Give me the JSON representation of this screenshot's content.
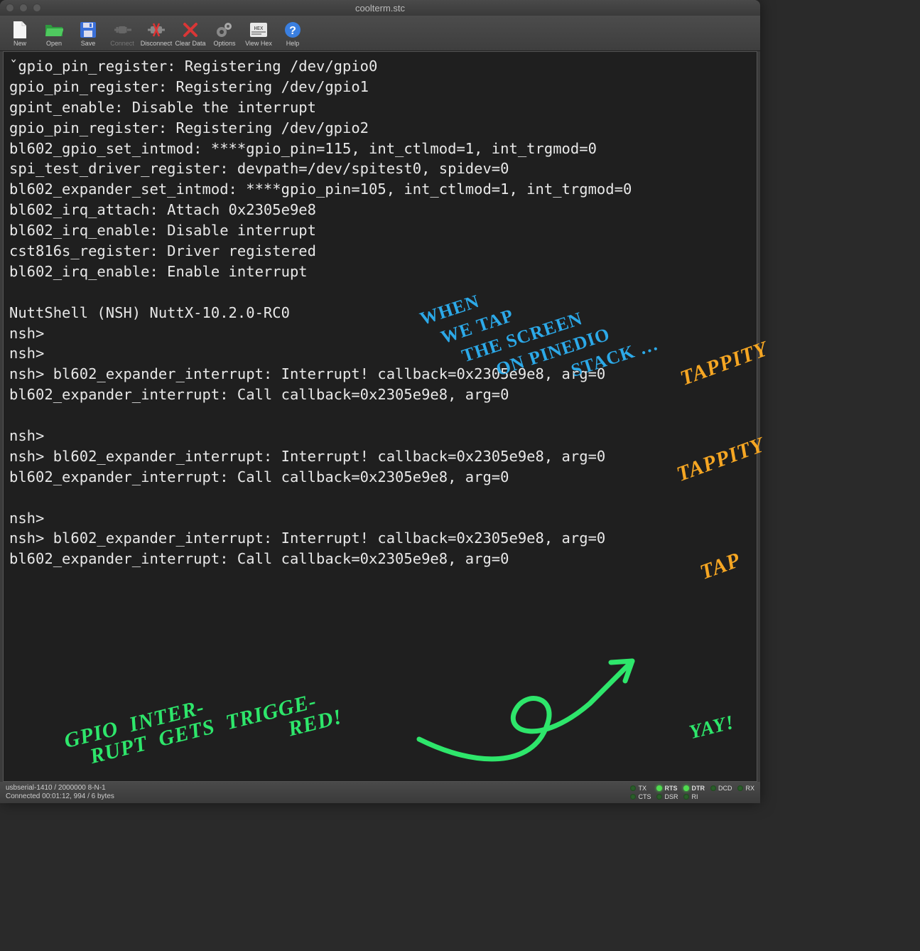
{
  "window": {
    "title": "coolterm.stc"
  },
  "toolbar": [
    {
      "id": "new",
      "label": "New",
      "disabled": false
    },
    {
      "id": "open",
      "label": "Open",
      "disabled": false
    },
    {
      "id": "save",
      "label": "Save",
      "disabled": false
    },
    {
      "id": "connect",
      "label": "Connect",
      "disabled": true
    },
    {
      "id": "disconnect",
      "label": "Disconnect",
      "disabled": false
    },
    {
      "id": "clear-data",
      "label": "Clear Data",
      "disabled": false
    },
    {
      "id": "options",
      "label": "Options",
      "disabled": false
    },
    {
      "id": "view-hex",
      "label": "View Hex",
      "disabled": false
    },
    {
      "id": "help",
      "label": "Help",
      "disabled": false
    }
  ],
  "terminal_text": "ˇgpio_pin_register: Registering /dev/gpio0\ngpio_pin_register: Registering /dev/gpio1\ngpint_enable: Disable the interrupt\ngpio_pin_register: Registering /dev/gpio2\nbl602_gpio_set_intmod: ****gpio_pin=115, int_ctlmod=1, int_trgmod=0\nspi_test_driver_register: devpath=/dev/spitest0, spidev=0\nbl602_expander_set_intmod: ****gpio_pin=105, int_ctlmod=1, int_trgmod=0\nbl602_irq_attach: Attach 0x2305e9e8\nbl602_irq_enable: Disable interrupt\ncst816s_register: Driver registered\nbl602_irq_enable: Enable interrupt\n\nNuttShell (NSH) NuttX-10.2.0-RC0\nnsh> \nnsh> \nnsh> bl602_expander_interrupt: Interrupt! callback=0x2305e9e8, arg=0\nbl602_expander_interrupt: Call callback=0x2305e9e8, arg=0\n\nnsh> \nnsh> bl602_expander_interrupt: Interrupt! callback=0x2305e9e8, arg=0\nbl602_expander_interrupt: Call callback=0x2305e9e8, arg=0\n\nnsh> \nnsh> bl602_expander_interrupt: Interrupt! callback=0x2305e9e8, arg=0\nbl602_expander_interrupt: Call callback=0x2305e9e8, arg=0",
  "status": {
    "line1": "usbserial-1410 / 2000000 8-N-1",
    "line2": "Connected 00:01:12, 994 / 6 bytes",
    "leds": [
      {
        "name": "TX",
        "on": false,
        "bold": false
      },
      {
        "name": "RTS",
        "on": true,
        "bold": true
      },
      {
        "name": "DTR",
        "on": true,
        "bold": true
      },
      {
        "name": "DCD",
        "on": false,
        "bold": false
      },
      {
        "name": "RX",
        "on": false,
        "bold": false
      },
      {
        "name": "CTS",
        "on": false,
        "bold": false
      },
      {
        "name": "DSR",
        "on": false,
        "bold": false
      },
      {
        "name": "RI",
        "on": false,
        "bold": false
      }
    ]
  },
  "annotations": {
    "blue": "When\nwe tap\nthe screen\non Pinedio\nStack …",
    "orange1": "Tappity",
    "orange2": "Tappity",
    "orange3": "Tap",
    "green": "GPIO Inter-\nrupt gets trigge-\nred!",
    "green_words": [
      "GPIO",
      "Inter-",
      "rupt",
      "gets",
      "trigge-",
      "red!"
    ],
    "yay": "Yay!"
  }
}
